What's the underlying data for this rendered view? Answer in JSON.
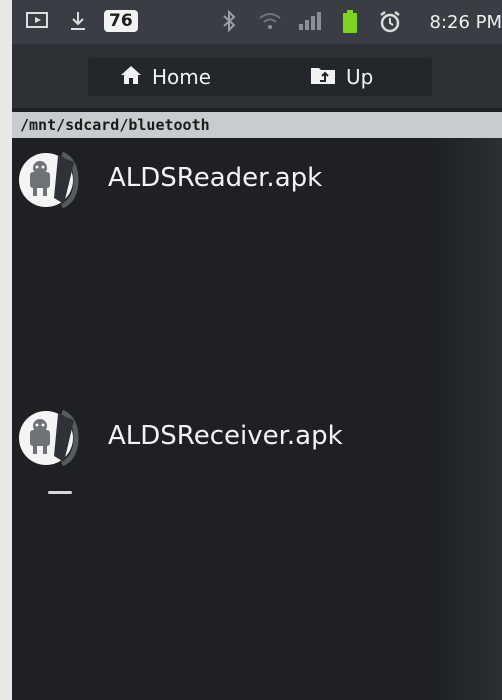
{
  "status_bar": {
    "battery_level": "76",
    "time": "8:26 PM",
    "icons": [
      "screen-icon",
      "download-icon",
      "bluetooth-icon",
      "wifi-icon",
      "signal-icon",
      "battery-icon",
      "alarm-icon"
    ]
  },
  "toolbar": {
    "home_label": "Home",
    "up_label": "Up"
  },
  "path": "/mnt/sdcard/bluetooth",
  "files": [
    {
      "name": "ALDSReader.apk",
      "icon": "apk-installer-icon"
    },
    {
      "name": "ALDSReceiver.apk",
      "icon": "apk-installer-icon"
    }
  ],
  "colors": {
    "background": "#1e2023",
    "status_bar": "#3a3e44",
    "toolbar": "#2c3136",
    "path_bar": "#c9ccce",
    "text": "#f4f4f4"
  }
}
